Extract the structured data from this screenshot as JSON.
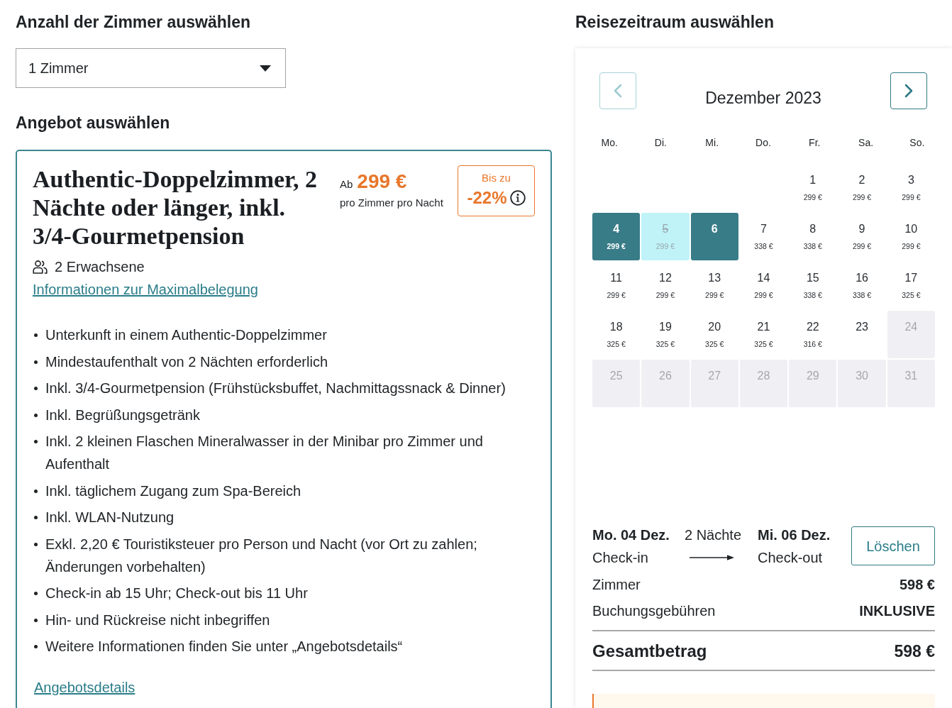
{
  "rooms": {
    "heading": "Anzahl der Zimmer auswählen",
    "select": {
      "value": "1 Zimmer"
    }
  },
  "offer": {
    "heading": "Angebot auswählen",
    "title": "Authentic-Doppelzimmer, 2 Nächte oder länger, inkl. 3/4-Gourmetpension",
    "price": {
      "prefix": "Ab",
      "amount": "299 €",
      "unit": "pro Zimmer pro Nacht"
    },
    "discount": {
      "label": "Bis zu",
      "value": "-22%"
    },
    "guests": "2 Erwachsene",
    "occupancy_link": "Informationen zur Maximalbelegung",
    "features": [
      "Unterkunft in einem Authentic-Doppelzimmer",
      "Mindestaufenthalt von 2 Nächten erforderlich",
      "Inkl. 3/4-Gourmetpension (Frühstücksbuffet, Nachmittagssnack & Dinner)",
      "Inkl. Begrüßungsgetränk",
      "Inkl. 2 kleinen Flaschen Mineralwasser in der Minibar pro Zimmer und Aufenthalt",
      "Inkl. täglichem Zugang zum Spa-Bereich",
      "Inkl. WLAN-Nutzung",
      "Exkl. 2,20 € Touristiksteuer pro Person und Nacht (vor Ort zu zahlen; Änderungen vorbehalten)",
      "Check-in ab 15 Uhr; Check-out bis 11 Uhr",
      "Hin- und Rückreise nicht inbegriffen",
      "Weitere Informationen finden Sie unter „Angebotsdetails“"
    ],
    "details_link": "Angebotsdetails"
  },
  "calendar": {
    "heading": "Reisezeitraum auswählen",
    "prev_button": {
      "disabled": true
    },
    "next_button": {
      "disabled": false
    },
    "month": "Dezember 2023",
    "weekdays": [
      "Mo.",
      "Di.",
      "Mi.",
      "Do.",
      "Fr.",
      "Sa.",
      "So."
    ],
    "weeks": [
      [
        {
          "day": "1",
          "price": "299 €",
          "selected": false,
          "in_range": false,
          "disabled": false
        },
        {
          "day": "2",
          "price": "299 €",
          "selected": false,
          "in_range": false,
          "disabled": false
        },
        {
          "day": "3",
          "price": "299 €",
          "selected": false,
          "in_range": false,
          "disabled": false
        }
      ],
      [
        {
          "day": "4",
          "price": "299 €",
          "selected": true,
          "in_range": false,
          "disabled": false
        },
        {
          "day": "5",
          "price": "299 €",
          "selected": false,
          "in_range": true,
          "disabled": false
        },
        {
          "day": "6",
          "selected": true,
          "in_range": false,
          "disabled": false
        },
        {
          "day": "7",
          "price": "338 €",
          "selected": false,
          "in_range": false,
          "disabled": false
        },
        {
          "day": "8",
          "price": "338 €",
          "selected": false,
          "in_range": false,
          "disabled": false
        },
        {
          "day": "9",
          "price": "299 €",
          "selected": false,
          "in_range": false,
          "disabled": false
        },
        {
          "day": "10",
          "price": "299 €",
          "selected": false,
          "in_range": false,
          "disabled": false
        }
      ],
      [
        {
          "day": "11",
          "price": "299 €",
          "selected": false,
          "in_range": false,
          "disabled": false
        },
        {
          "day": "12",
          "price": "299 €",
          "selected": false,
          "in_range": false,
          "disabled": false
        },
        {
          "day": "13",
          "price": "299 €",
          "selected": false,
          "in_range": false,
          "disabled": false
        },
        {
          "day": "14",
          "price": "299 €",
          "selected": false,
          "in_range": false,
          "disabled": false
        },
        {
          "day": "15",
          "price": "338 €",
          "selected": false,
          "in_range": false,
          "disabled": false
        },
        {
          "day": "16",
          "price": "338 €",
          "selected": false,
          "in_range": false,
          "disabled": false
        },
        {
          "day": "17",
          "price": "325 €",
          "selected": false,
          "in_range": false,
          "disabled": false
        }
      ],
      [
        {
          "day": "18",
          "price": "325 €",
          "selected": false,
          "in_range": false,
          "disabled": false
        },
        {
          "day": "19",
          "price": "325 €",
          "selected": false,
          "in_range": false,
          "disabled": false
        },
        {
          "day": "20",
          "price": "325 €",
          "selected": false,
          "in_range": false,
          "disabled": false
        },
        {
          "day": "21",
          "price": "325 €",
          "selected": false,
          "in_range": false,
          "disabled": false
        },
        {
          "day": "22",
          "price": "316 €",
          "selected": false,
          "in_range": false,
          "disabled": false
        },
        {
          "day": "23",
          "selected": false,
          "in_range": false,
          "disabled": false
        },
        {
          "day": "24",
          "selected": false,
          "in_range": false,
          "disabled": true
        }
      ],
      [
        {
          "day": "25",
          "selected": false,
          "in_range": false,
          "disabled": true
        },
        {
          "day": "26",
          "selected": false,
          "in_range": false,
          "disabled": true
        },
        {
          "day": "27",
          "selected": false,
          "in_range": false,
          "disabled": true
        },
        {
          "day": "28",
          "selected": false,
          "in_range": false,
          "disabled": true
        },
        {
          "day": "29",
          "selected": false,
          "in_range": false,
          "disabled": true
        },
        {
          "day": "30",
          "selected": false,
          "in_range": false,
          "disabled": true
        },
        {
          "day": "31",
          "selected": false,
          "in_range": false,
          "disabled": true
        }
      ]
    ]
  },
  "summary": {
    "check_in": {
      "date": "Mo. 04 Dez.",
      "label": "Check-in"
    },
    "nights": "2 Nächte",
    "check_out": {
      "date": "Mi. 06 Dez.",
      "label": "Check-out"
    },
    "clear_button": "Löschen",
    "lines": [
      {
        "label": "Zimmer",
        "value": "598 €"
      },
      {
        "label": "Buchungsgebühren",
        "value": "INKLUSIVE"
      }
    ],
    "total": {
      "label": "Gesamtbetrag",
      "value": "598 €"
    }
  }
}
